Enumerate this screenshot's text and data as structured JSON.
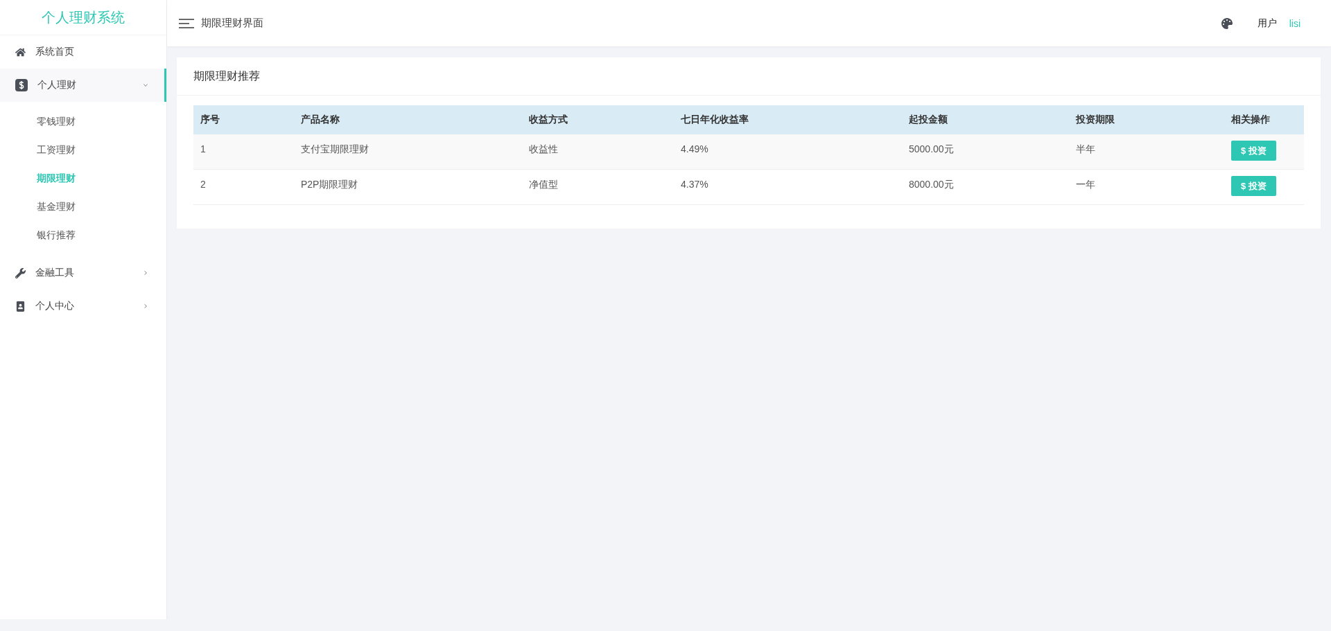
{
  "logo": "个人理财系统",
  "sidebar": {
    "items": [
      {
        "label": "系统首页",
        "kind": "home",
        "selected": false
      },
      {
        "label": "个人理财",
        "kind": "finance",
        "selected": true,
        "expanded": true,
        "children": [
          {
            "label": "零钱理财",
            "selected": false
          },
          {
            "label": "工资理财",
            "selected": false
          },
          {
            "label": "期限理财",
            "selected": true
          },
          {
            "label": "基金理财",
            "selected": false
          },
          {
            "label": "银行推荐",
            "selected": false
          }
        ]
      },
      {
        "label": "金融工具",
        "kind": "tools",
        "selected": false,
        "expanded": false
      },
      {
        "label": "个人中心",
        "kind": "profile",
        "selected": false,
        "expanded": false
      }
    ]
  },
  "header": {
    "title": "期限理财界面",
    "user_label": "用户",
    "user_name": "lisi"
  },
  "card": {
    "title": "期限理财推荐",
    "table": {
      "columns": [
        "序号",
        "产品名称",
        "收益方式",
        "七日年化收益率",
        "起投金额",
        "投资期限",
        "相关操作"
      ],
      "rows": [
        {
          "cells": [
            "1",
            "支付宝期限理财",
            "收益性",
            "4.49%",
            "5000.00元",
            "半年"
          ],
          "action": "$ 投资"
        },
        {
          "cells": [
            "2",
            "P2P期限理财",
            "净值型",
            "4.37%",
            "8000.00元",
            "一年"
          ],
          "action": "$ 投资"
        }
      ]
    }
  }
}
